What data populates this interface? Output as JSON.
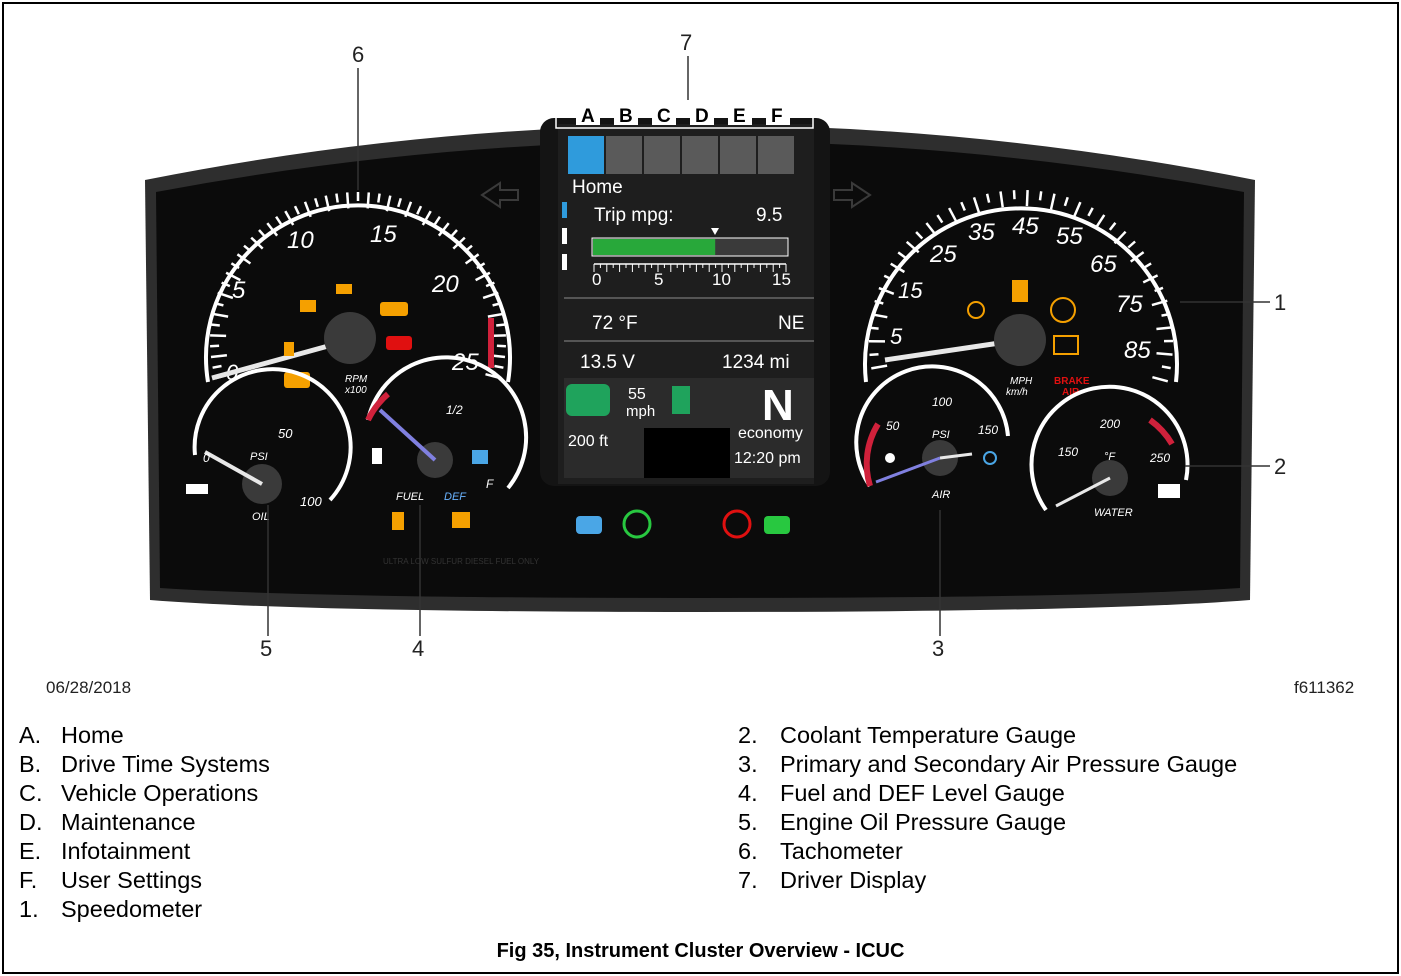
{
  "callouts": [
    "1",
    "2",
    "3",
    "4",
    "5",
    "6",
    "7"
  ],
  "date": "06/28/2018",
  "figure_id": "f611362",
  "display": {
    "tabs": [
      "A",
      "B",
      "C",
      "D",
      "E",
      "F"
    ],
    "menu_title": "Home",
    "trip_label": "Trip mpg:",
    "trip_value": "9.5",
    "trip_scale": [
      "0",
      "5",
      "10",
      "15"
    ],
    "trip_level_fraction": 0.63,
    "temp": "72 °F",
    "heading": "NE",
    "voltage": "13.5  V",
    "odometer": "1234 mi",
    "speed_value": "55",
    "speed_unit": "mph",
    "distance": "200 ft",
    "gear": "N",
    "mode": "economy",
    "time": "12:20 pm"
  },
  "tachometer": {
    "labels": [
      "0",
      "5",
      "10",
      "15",
      "20",
      "25"
    ],
    "unit_1": "RPM",
    "unit_2": "x100"
  },
  "speedometer": {
    "labels": [
      "5",
      "15",
      "25",
      "35",
      "45",
      "55",
      "65",
      "75",
      "85"
    ],
    "unit_1": "MPH",
    "unit_2": "km/h",
    "brake_1": "BRAKE",
    "brake_2": "AIR"
  },
  "oil_gauge": {
    "labels": [
      "0",
      "50",
      "100"
    ],
    "unit": "PSI",
    "name": "OIL"
  },
  "fuel_gauge": {
    "labels": [
      "1/2",
      "F"
    ],
    "fuel": "FUEL",
    "def": "DEF",
    "note": "ULTRA LOW SULFUR DIESEL FUEL ONLY"
  },
  "air_gauge": {
    "labels": [
      "50",
      "100",
      "150"
    ],
    "unit": "PSI",
    "name": "AIR"
  },
  "water_gauge": {
    "labels": [
      "150",
      "200",
      "250"
    ],
    "unit": "°F",
    "name": "WATER"
  },
  "legend_left": [
    {
      "key": "A.",
      "text": "Home"
    },
    {
      "key": "B.",
      "text": "Drive Time Systems"
    },
    {
      "key": "C.",
      "text": "Vehicle Operations"
    },
    {
      "key": "D.",
      "text": "Maintenance"
    },
    {
      "key": "E.",
      "text": "Infotainment"
    },
    {
      "key": "F.",
      "text": "User Settings"
    },
    {
      "key": "1.",
      "text": "Speedometer"
    }
  ],
  "legend_right": [
    {
      "key": "2.",
      "text": "Coolant Temperature Gauge"
    },
    {
      "key": "3.",
      "text": "Primary and Secondary Air Pressure Gauge"
    },
    {
      "key": "4.",
      "text": "Fuel and DEF Level Gauge"
    },
    {
      "key": "5.",
      "text": "Engine Oil Pressure Gauge"
    },
    {
      "key": "6.",
      "text": "Tachometer"
    },
    {
      "key": "7.",
      "text": "Driver Display"
    }
  ],
  "caption": "Fig 35, Instrument Cluster Overview - ICUC",
  "colors": {
    "cluster": "#0a0a0a",
    "bezel": "#3a3a3a",
    "warning": "#f5a000",
    "alert": "#e01010",
    "display_bar": "#28a83a",
    "tab_active": "#2f9bdc"
  }
}
